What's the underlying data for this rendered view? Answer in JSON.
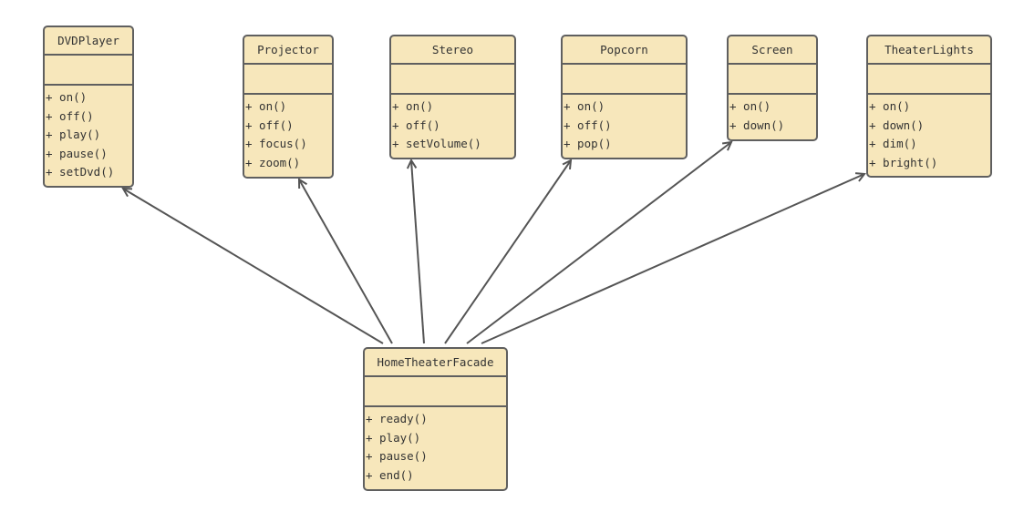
{
  "colors": {
    "fill": "#f7e7bb",
    "stroke": "#5f5f5f",
    "edge": "#555555"
  },
  "classes": [
    {
      "id": "dvd",
      "name": "DVDPlayer",
      "methods": [
        "+ on()",
        "+ off()",
        "+ play()",
        "+ pause()",
        "+ setDvd()"
      ]
    },
    {
      "id": "projector",
      "name": "Projector",
      "methods": [
        "+ on()",
        "+ off()",
        "+ focus()",
        "+ zoom()"
      ]
    },
    {
      "id": "stereo",
      "name": "Stereo",
      "methods": [
        "+ on()",
        "+ off()",
        "+ setVolume()"
      ]
    },
    {
      "id": "popcorn",
      "name": "Popcorn",
      "methods": [
        "+ on()",
        "+ off()",
        "+ pop()"
      ]
    },
    {
      "id": "screen",
      "name": "Screen",
      "methods": [
        "+ on()",
        "+ down()"
      ]
    },
    {
      "id": "lights",
      "name": "TheaterLights",
      "methods": [
        "+ on()",
        "+ down()",
        "+ dim()",
        "+ bright()"
      ]
    },
    {
      "id": "facade",
      "name": "HomeTheaterFacade",
      "methods": [
        "+ ready()",
        "+ play()",
        "+ pause()",
        "+ end()"
      ]
    }
  ],
  "associations": [
    {
      "from": "facade",
      "to": "dvd"
    },
    {
      "from": "facade",
      "to": "projector"
    },
    {
      "from": "facade",
      "to": "stereo"
    },
    {
      "from": "facade",
      "to": "popcorn"
    },
    {
      "from": "facade",
      "to": "screen"
    },
    {
      "from": "facade",
      "to": "lights"
    }
  ]
}
